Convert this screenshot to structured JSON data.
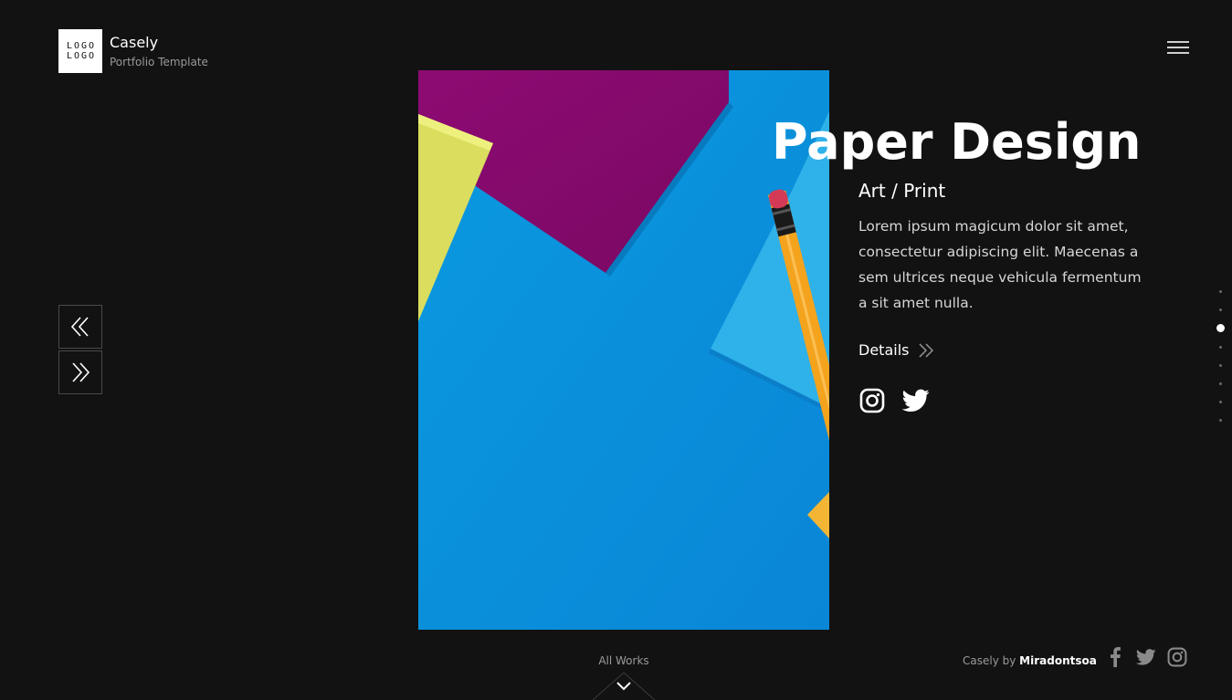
{
  "header": {
    "logo_lines": [
      "LOGO",
      "LOGO"
    ],
    "brand_name": "Casely",
    "brand_subtitle": "Portfolio Template",
    "menu_icon": "hamburger-menu-icon"
  },
  "navigation": {
    "prev_icon": "double-chevron-left-icon",
    "next_icon": "double-chevron-right-icon"
  },
  "project": {
    "title": "Paper Design",
    "category": "Art / Print",
    "description": "Lorem ipsum magicum dolor sit amet, consectetur adipiscing elit. Maecenas a sem ultrices neque vehicula fermentum a sit amet nulla.",
    "details_label": "Details",
    "details_icon": "double-chevron-right-icon",
    "social_icons": [
      "instagram-icon",
      "twitter-icon"
    ]
  },
  "pagination": {
    "total": 8,
    "active_index": 2
  },
  "footer": {
    "all_works_label": "All Works",
    "all_works_icon": "chevron-down-icon",
    "credit_prefix": "Casely by",
    "credit_author": "Miradontsoa",
    "social_icons": [
      "facebook-icon",
      "twitter-icon",
      "instagram-icon"
    ]
  },
  "colors": {
    "background": "#121212",
    "image_blue": "#0d8fd9",
    "paper_magenta": "#8a0a6e",
    "paper_yellow": "#d8dc5c",
    "pencil_orange": "#f4a31d"
  }
}
